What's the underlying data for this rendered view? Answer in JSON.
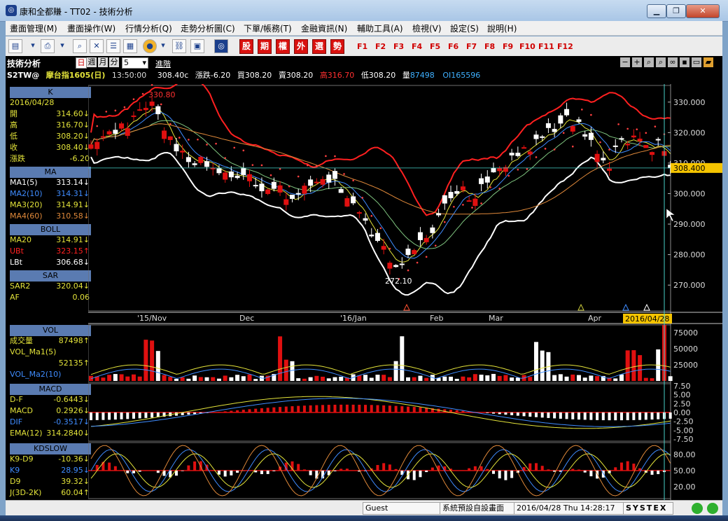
{
  "window": {
    "title": "康和全都賺 - TT02 - 技術分析",
    "min": "▁",
    "max": "❐",
    "close": "✕"
  },
  "menu": [
    "畫面管理(M)",
    "畫面操作(W)",
    "行情分析(Q)",
    "走勢分析圖(C)",
    "下單/帳務(T)",
    "金融資訊(N)",
    "輔助工具(A)",
    "檢視(V)",
    "設定(S)",
    "說明(H)"
  ],
  "toolbar": {
    "quick": [
      "股",
      "期",
      "權",
      "外",
      "選",
      "勢"
    ],
    "fkeys": [
      "F1",
      "F2",
      "F3",
      "F4",
      "F5",
      "F6",
      "F7",
      "F8",
      "F9",
      "F10",
      "F11",
      "F12"
    ]
  },
  "header": {
    "title": "技術分析",
    "periods": [
      "日",
      "週",
      "月",
      "分"
    ],
    "active_period": "日",
    "minutes": "5",
    "advanced": "進階",
    "symbol": "S2TW@",
    "name": "摩台指1605(日)",
    "time": "13:50:00",
    "price": "308.40c",
    "change": "漲跌-6.20",
    "bid": "買308.20",
    "ask": "賣308.20",
    "high": "高316.70",
    "low": "低308.20",
    "volume_label": "量",
    "volume": "87498",
    "oi": "OI165596"
  },
  "panel_k": {
    "head": "K",
    "date": "2016/04/28",
    "rows": [
      {
        "label": "開",
        "value": "314.60",
        "arrow": "↓"
      },
      {
        "label": "高",
        "value": "316.70",
        "arrow": "↓"
      },
      {
        "label": "低",
        "value": "308.20",
        "arrow": "↓"
      },
      {
        "label": "收",
        "value": "308.40",
        "arrow": "↓"
      },
      {
        "label": "漲跌",
        "value": "-6.20",
        "arrow": ""
      }
    ]
  },
  "panel_ma": {
    "head": "MA",
    "rows": [
      {
        "label": "MA1(5)",
        "value": "313.14",
        "arrow": "↓",
        "color": "#ffffff"
      },
      {
        "label": "MA2(10)",
        "value": "314.31",
        "arrow": "↓",
        "color": "#3f8cff"
      },
      {
        "label": "MA3(20)",
        "value": "314.91",
        "arrow": "↓",
        "color": "#e3e33a"
      },
      {
        "label": "MA4(60)",
        "value": "310.58",
        "arrow": "↓",
        "color": "#e0893a"
      }
    ]
  },
  "panel_boll": {
    "head": "BOLL",
    "rows": [
      {
        "label": "MA20",
        "value": "314.91",
        "arrow": "↓",
        "color": "#e3e33a"
      },
      {
        "label": "UBt",
        "value": "323.15",
        "arrow": "↑",
        "color": "#ff2020"
      },
      {
        "label": "LBt",
        "value": "306.68",
        "arrow": "↓",
        "color": "#ffffff"
      }
    ]
  },
  "panel_sar": {
    "head": "SAR",
    "rows": [
      {
        "label": "SAR2",
        "value": "320.04",
        "arrow": "↓",
        "color": "#e3e33a"
      },
      {
        "label": "AF",
        "value": "0.06",
        "arrow": "",
        "color": "#e3e33a"
      }
    ]
  },
  "panel_vol": {
    "head": "VOL",
    "rows": [
      {
        "label": "成交量",
        "value": "87498",
        "arrow": "↑",
        "color": "#e3e33a"
      },
      {
        "label": "VOL_Ma1(5)",
        "value": "",
        "arrow": "",
        "color": "#e3e33a"
      },
      {
        "label": "",
        "value": "52135",
        "arrow": "↑",
        "color": "#e3e33a"
      },
      {
        "label": "VOL_Ma2(10)",
        "value": "",
        "arrow": "",
        "color": "#3f8cff"
      }
    ]
  },
  "panel_macd": {
    "head": "MACD",
    "rows": [
      {
        "label": "D-F",
        "value": "-0.6443",
        "arrow": "↓",
        "color": "#e3e33a"
      },
      {
        "label": "MACD",
        "value": "0.2926",
        "arrow": "↓",
        "color": "#e3e33a"
      },
      {
        "label": "DIF",
        "value": "-0.3517",
        "arrow": "↓",
        "color": "#3f8cff"
      },
      {
        "label": "EMA(12)",
        "value": "314.2840",
        "arrow": "↓",
        "color": "#e3e33a"
      }
    ]
  },
  "panel_kd": {
    "head": "KDSLOW",
    "rows": [
      {
        "label": "K9-D9",
        "value": "-10.36",
        "arrow": "↓",
        "color": "#e3e33a"
      },
      {
        "label": "K9",
        "value": "28.95",
        "arrow": "↓",
        "color": "#3f8cff"
      },
      {
        "label": "D9",
        "value": "39.32",
        "arrow": "↓",
        "color": "#e3e33a"
      },
      {
        "label": "J(3D-2K)",
        "value": "60.04",
        "arrow": "↑",
        "color": "#e3e33a"
      }
    ]
  },
  "price_chart": {
    "y_ticks": [
      "330.000",
      "320.000",
      "310.000",
      "300.000",
      "290.000",
      "280.000",
      "270.000"
    ],
    "x_ticks": [
      "'15/Nov",
      "Dec",
      "'16/Jan",
      "Feb",
      "Mar",
      "Apr"
    ],
    "last_price": "308.400",
    "high_mark": "330.80",
    "low_mark": "272.10",
    "cursor_date": "2016/04/28"
  },
  "volume_chart": {
    "y_ticks": [
      "75000",
      "50000",
      "25000"
    ]
  },
  "macd_chart": {
    "y_ticks": [
      "7.50",
      "5.00",
      "2.50",
      "0.00",
      "-2.50",
      "-5.00",
      "-7.50"
    ]
  },
  "kd_chart": {
    "y_ticks": [
      "80.00",
      "50.00",
      "20.00"
    ]
  },
  "status": {
    "user": "Guest",
    "layout": "系統預設自設畫面",
    "datetime": "2016/04/28 Thu 14:28:17",
    "brand": "SYSTEX"
  },
  "colors": {
    "up": "#e01010",
    "down": "#ffffff",
    "sar": "#ff2020",
    "ma_yellow": "#e3e33a",
    "ma_blue": "#3f8cff",
    "ma_orange": "#e0893a"
  }
}
